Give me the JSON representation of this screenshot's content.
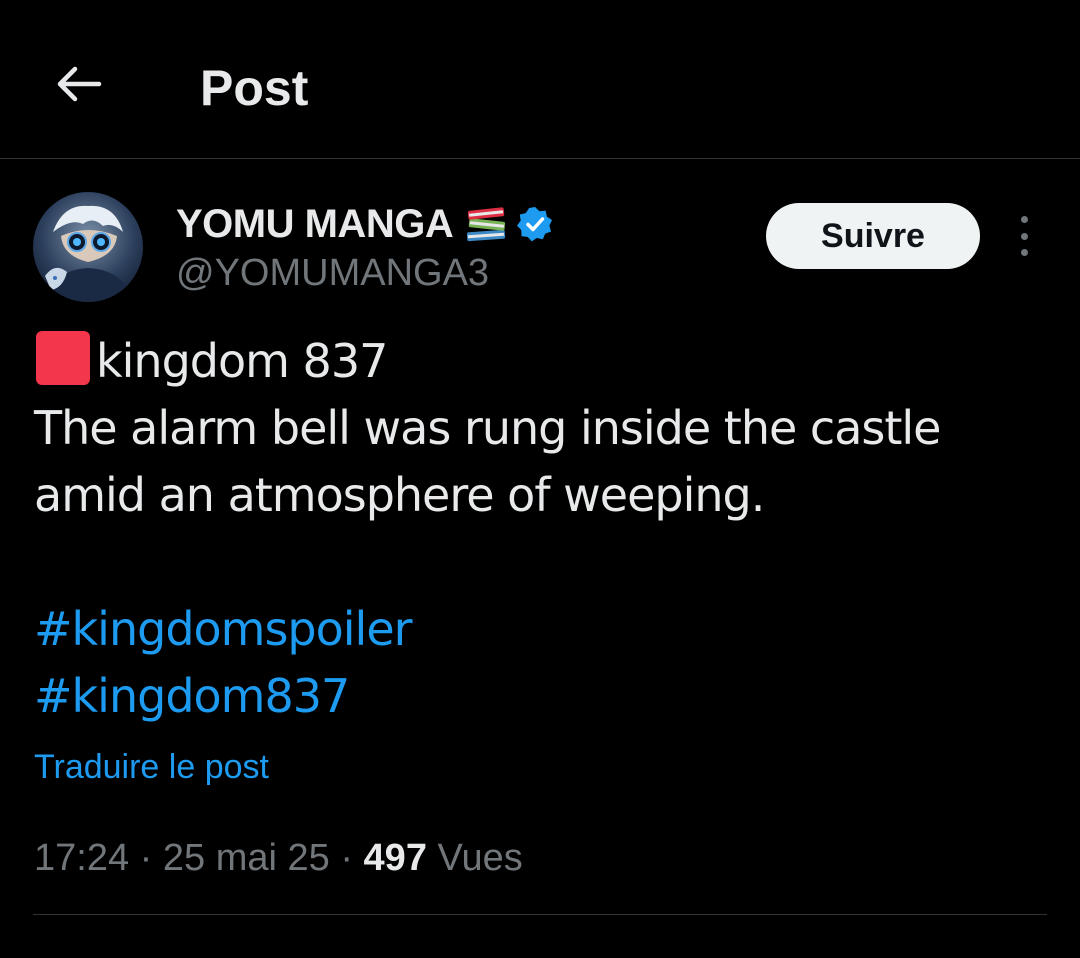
{
  "header": {
    "title": "Post",
    "back_icon": "arrow-left-icon"
  },
  "author": {
    "name": "YOMU MANGA",
    "name_emoji_icon": "books-icon",
    "verified_icon": "verified-badge-icon",
    "handle": "@YOMUMANGA3",
    "avatar_icon": "avatar"
  },
  "actions": {
    "follow_label": "Suivre",
    "more_icon": "more-vertical-icon"
  },
  "tweet": {
    "emoji_icon": "red-square-emoji",
    "line1": "kingdom 837",
    "line2": "The alarm bell was rung inside the castle",
    "line3": "amid an atmosphere of weeping.",
    "hashtags": [
      "#kingdomspoiler",
      "#kingdom837"
    ]
  },
  "translate_label": "Traduire le post",
  "meta": {
    "time": "17:24",
    "separator": "·",
    "date": "25 mai 25",
    "views_count": "497",
    "views_label": "Vues"
  },
  "colors": {
    "background": "#000000",
    "text_primary": "#e7e9ea",
    "text_secondary": "#71767b",
    "accent": "#1d9bf0",
    "follow_bg": "#eff3f4",
    "divider": "#2f3336",
    "red_square": "#f4364c"
  }
}
